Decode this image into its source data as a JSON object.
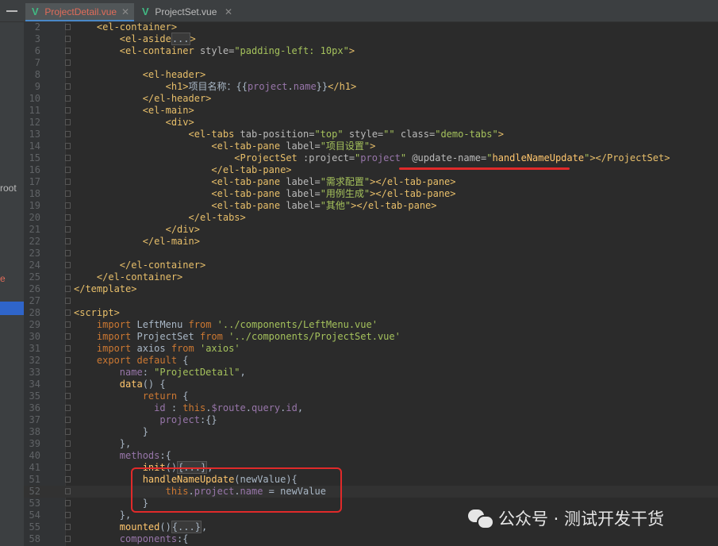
{
  "tabs": [
    {
      "label": "ProjectDetail.vue",
      "active": true
    },
    {
      "label": "ProjectSet.vue",
      "active": false
    }
  ],
  "side_fragments": [
    "root",
    "e"
  ],
  "code_lines": [
    {
      "n": "2",
      "html": "    <span class='t'>&lt;el-container&gt;</span>"
    },
    {
      "n": "3",
      "html": "        <span class='t'>&lt;el-aside</span><span class='fd'>...</span><span class='t'>&gt;</span>"
    },
    {
      "n": "6",
      "html": "        <span class='t'>&lt;el-container</span> <span class='a'>style=</span><span class='s'>\"padding-left: 10px\"</span><span class='t'>&gt;</span>"
    },
    {
      "n": "7",
      "html": ""
    },
    {
      "n": "8",
      "html": "            <span class='t'>&lt;el-header&gt;</span>"
    },
    {
      "n": "9",
      "html": "                <span class='t'>&lt;h1&gt;</span>项目名称：{{<span class='pr'>project</span>.<span class='pr'>name</span>}}<span class='t'>&lt;/h1&gt;</span>"
    },
    {
      "n": "10",
      "html": "            <span class='t'>&lt;/el-header&gt;</span>"
    },
    {
      "n": "11",
      "html": "            <span class='t'>&lt;el-main&gt;</span>"
    },
    {
      "n": "12",
      "html": "                <span class='t'>&lt;div&gt;</span>"
    },
    {
      "n": "13",
      "html": "                    <span class='t'>&lt;el-tabs</span> <span class='a'>tab-position=</span><span class='s'>\"top\"</span> <span class='a'>style=</span><span class='s'>\"\"</span> <span class='a'>class=</span><span class='s'>\"demo-tabs\"</span><span class='t'>&gt;</span>"
    },
    {
      "n": "14",
      "html": "                        <span class='t'>&lt;el-tab-pane</span> <span class='a'>label=</span><span class='s'>\"项目设置\"</span><span class='t'>&gt;</span>"
    },
    {
      "n": "15",
      "html": "                            <span class='t'>&lt;ProjectSet</span> <span class='a'>:project=</span><span class='s'>\"</span><span class='pr'>project</span><span class='s'>\"</span> <span class='a'>@update-name=</span><span class='s'>\"</span><span class='fn'>handleNameUpdate</span><span class='s'>\"</span><span class='t'>&gt;&lt;/ProjectSet&gt;</span>"
    },
    {
      "n": "16",
      "html": "                        <span class='t'>&lt;/el-tab-pane&gt;</span>"
    },
    {
      "n": "17",
      "html": "                        <span class='t'>&lt;el-tab-pane</span> <span class='a'>label=</span><span class='s'>\"需求配置\"</span><span class='t'>&gt;&lt;/el-tab-pane&gt;</span>"
    },
    {
      "n": "18",
      "html": "                        <span class='t'>&lt;el-tab-pane</span> <span class='a'>label=</span><span class='s'>\"用例生成\"</span><span class='t'>&gt;&lt;/el-tab-pane&gt;</span>"
    },
    {
      "n": "19",
      "html": "                        <span class='t'>&lt;el-tab-pane</span> <span class='a'>label=</span><span class='s'>\"其他\"</span><span class='t'>&gt;&lt;/el-tab-pane&gt;</span>"
    },
    {
      "n": "20",
      "html": "                    <span class='t'>&lt;/el-tabs&gt;</span>"
    },
    {
      "n": "21",
      "html": "                <span class='t'>&lt;/div&gt;</span>"
    },
    {
      "n": "22",
      "html": "            <span class='t'>&lt;/el-main&gt;</span>"
    },
    {
      "n": "23",
      "html": ""
    },
    {
      "n": "24",
      "html": "        <span class='t'>&lt;/el-container&gt;</span>"
    },
    {
      "n": "25",
      "html": "    <span class='t'>&lt;/el-container&gt;</span>"
    },
    {
      "n": "26",
      "html": "<span class='t'>&lt;/template&gt;</span>"
    },
    {
      "n": "27",
      "html": ""
    },
    {
      "n": "28",
      "html": "<span class='t'>&lt;script&gt;</span>"
    },
    {
      "n": "29",
      "html": "    <span class='k'>import</span> LeftMenu <span class='k'>from</span> <span class='s'>'../components/LeftMenu.vue'</span>"
    },
    {
      "n": "30",
      "html": "    <span class='k'>import</span> ProjectSet <span class='k'>from</span> <span class='s'>'../components/ProjectSet.vue'</span>"
    },
    {
      "n": "31",
      "html": "    <span class='k'>import</span> axios <span class='k'>from</span> <span class='s'>'axios'</span>"
    },
    {
      "n": "32",
      "html": "    <span class='k'>export default</span> {"
    },
    {
      "n": "33",
      "html": "        <span class='pr'>name</span>: <span class='s'>\"ProjectDetail\"</span>,"
    },
    {
      "n": "34",
      "html": "        <span class='fn'>data</span>() {"
    },
    {
      "n": "35",
      "html": "            <span class='k'>return</span> {"
    },
    {
      "n": "36",
      "html": "              <span class='pr'>id</span> : <span class='k'>this</span>.<span class='pr'>$route</span>.<span class='pr'>query</span>.<span class='pr'>id</span>,"
    },
    {
      "n": "37",
      "html": "               <span class='pr'>project</span>:{}"
    },
    {
      "n": "38",
      "html": "            }"
    },
    {
      "n": "39",
      "html": "        },"
    },
    {
      "n": "40",
      "html": "        <span class='pr'>methods</span>:{"
    },
    {
      "n": "41",
      "html": "            <span class='fn'>init</span>()<span class='fd'>{...}</span>,"
    },
    {
      "n": "51",
      "html": "            <span class='fn'>handleNameUpdate</span>(newValue){"
    },
    {
      "n": "52",
      "html": "                <span class='k'>this</span>.<span class='pr'>project</span>.<span class='pr'>name</span> = newValue"
    },
    {
      "n": "53",
      "html": "            }"
    },
    {
      "n": "54",
      "html": "        },"
    },
    {
      "n": "55",
      "html": "        <span class='fn'>mounted</span>()<span class='fd'>{...}</span>,"
    },
    {
      "n": "58",
      "html": "        <span class='pr'>components</span>:{"
    }
  ],
  "current_line": "52",
  "watermark": "公众号 · 测试开发干货"
}
